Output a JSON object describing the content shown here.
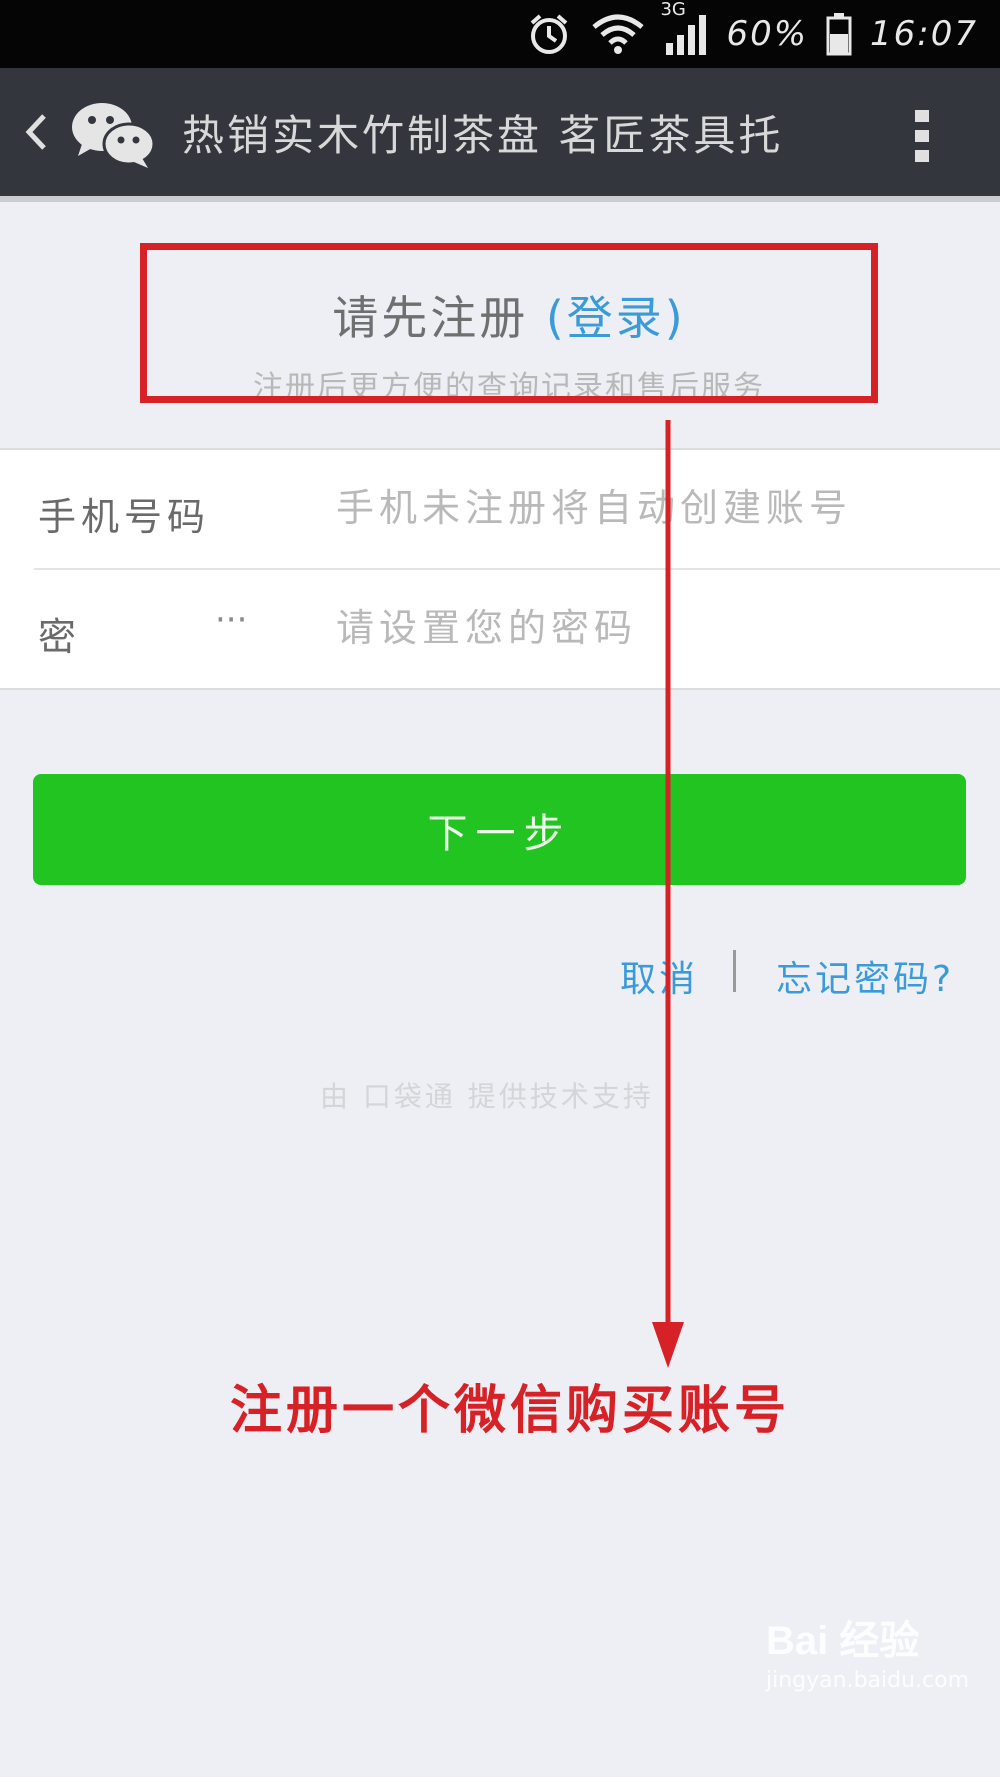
{
  "status_bar": {
    "network": "3G",
    "battery": "60%",
    "time": "16:07"
  },
  "title_bar": {
    "title": "热销实木竹制茶盘 茗匠茶具托"
  },
  "register": {
    "title_main": "请先注册",
    "title_login": "(登录)",
    "subtitle": "注册后更方便的查询记录和售后服务"
  },
  "form": {
    "phone_label": "手机号码",
    "phone_placeholder": "手机未注册将自动创建账号",
    "password_label": "密",
    "password_dots": "···",
    "password_placeholder": "请设置您的密码"
  },
  "actions": {
    "next_label": "下一步",
    "cancel_label": "取消",
    "forgot_label": "忘记密码?"
  },
  "footer": {
    "support_text": "由 口袋通 提供技术支持"
  },
  "annotation": {
    "caption": "注册一个微信购买账号",
    "color": "#d62126"
  },
  "watermark": {
    "brand": "Bai 经验",
    "url": "jingyan.baidu.com"
  },
  "colors": {
    "accent_green": "#22c422",
    "link_blue": "#3a9bd8"
  }
}
